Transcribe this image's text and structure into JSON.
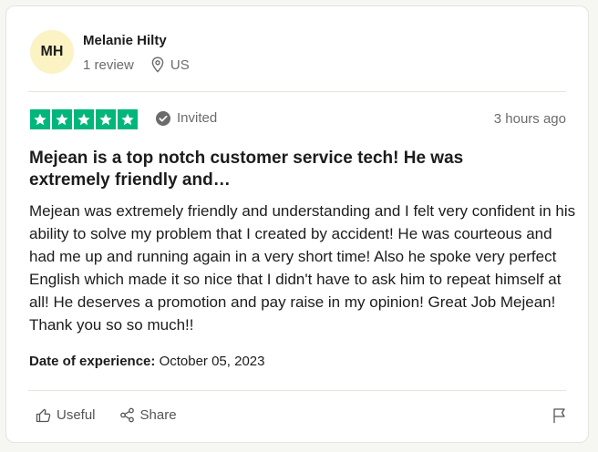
{
  "reviewer": {
    "initials": "MH",
    "name": "Melanie Hilty",
    "review_count": "1 review",
    "country": "US"
  },
  "rating": {
    "stars": 5,
    "max": 5,
    "star_color": "#00b67a"
  },
  "verification": "Invited",
  "time_ago": "3 hours ago",
  "review": {
    "title": "Mejean is a top notch customer service tech! He was extremely friendly and…",
    "body": "Mejean was extremely friendly and understanding and I felt very confident in his ability to solve my problem that I created by accident! He was courteous and had me up and running again in a very short time! Also he spoke very perfect English which made it so nice that I didn't have to ask him to repeat himself at all! He deserves a promotion and pay raise in my opinion! Great Job Mejean! Thank you so so much!!"
  },
  "date_of_experience": {
    "label": "Date of experience:",
    "value": "October 05, 2023"
  },
  "actions": {
    "useful_label": "Useful",
    "share_label": "Share"
  },
  "icons": {
    "location": "location-pin-icon",
    "verified": "check-circle-icon",
    "useful": "thumbs-up-icon",
    "share": "share-icon",
    "report": "flag-icon"
  }
}
